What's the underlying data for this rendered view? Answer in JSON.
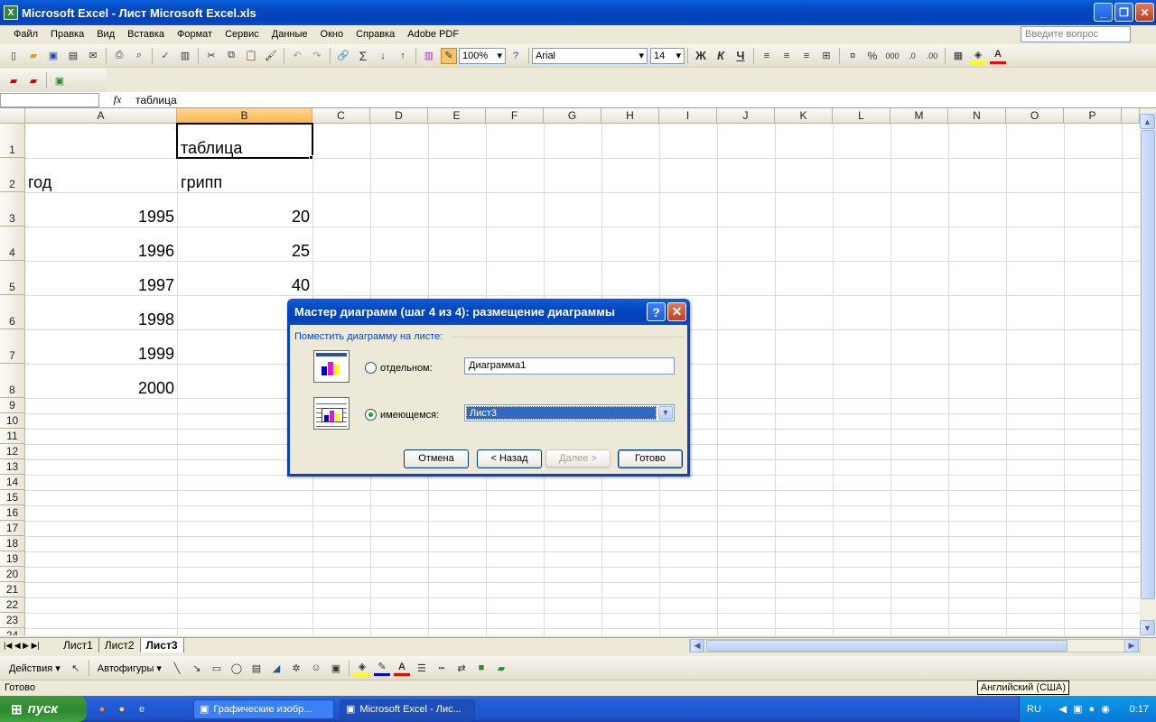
{
  "window": {
    "title": "Microsoft Excel - Лист Microsoft Excel.xls",
    "btn_min": "_",
    "btn_restore": "❐",
    "btn_close": "✕"
  },
  "menu": {
    "items": [
      "Файл",
      "Правка",
      "Вид",
      "Вставка",
      "Формат",
      "Сервис",
      "Данные",
      "Окно",
      "Справка",
      "Adobe PDF"
    ],
    "help_placeholder": "Введите вопрос"
  },
  "toolbar": {
    "zoom": "100%",
    "font": "Arial",
    "size": "14",
    "bold": "Ж",
    "italic": "К",
    "underline": "Ч",
    "percent": "%",
    "thousands": "000"
  },
  "formula": {
    "namebox": "",
    "fx": "fx",
    "content": "таблица"
  },
  "grid": {
    "columns": [
      "A",
      "B",
      "C",
      "D",
      "E",
      "F",
      "G",
      "H",
      "I",
      "J",
      "K",
      "L",
      "M",
      "N",
      "O",
      "P"
    ],
    "rows": [
      "1",
      "2",
      "3",
      "4",
      "5",
      "6",
      "7",
      "8",
      "9",
      "10",
      "11",
      "12",
      "13",
      "14",
      "15",
      "16",
      "17",
      "18",
      "19",
      "20",
      "21",
      "22",
      "23",
      "24"
    ],
    "selected_column": "B",
    "cells": {
      "B1": "таблица",
      "A2": "год",
      "B2": "грипп",
      "A3": "1995",
      "B3": "20",
      "A4": "1996",
      "B4": "25",
      "A5": "1997",
      "B5": "40",
      "A6": "1998",
      "A7": "1999",
      "A8": "2000"
    }
  },
  "sheets": {
    "tabs": [
      "Лист1",
      "Лист2",
      "Лист3"
    ],
    "active": "Лист3"
  },
  "drawbar": {
    "actions": "Действия",
    "autoshapes": "Автофигуры"
  },
  "status": {
    "text": "Готово",
    "lang_tip": "Английский (США)"
  },
  "taskbar": {
    "start": "пуск",
    "tasks": [
      "Графические изобр...",
      "Microsoft Excel - Лис..."
    ],
    "lang": "RU",
    "clock": "0:17"
  },
  "dialog": {
    "title": "Мастер диаграмм (шаг 4 из 4): размещение диаграммы",
    "help": "?",
    "close": "✕",
    "group": "Поместить диаграмму на листе:",
    "option_separate": {
      "label": "отдельном:",
      "value": "Диаграмма1",
      "selected": false
    },
    "option_existing": {
      "label": "имеющемся:",
      "value": "Лист3",
      "selected": true
    },
    "buttons": {
      "cancel": "Отмена",
      "back": "< Назад",
      "next": "Далее >",
      "finish": "Готово"
    }
  }
}
